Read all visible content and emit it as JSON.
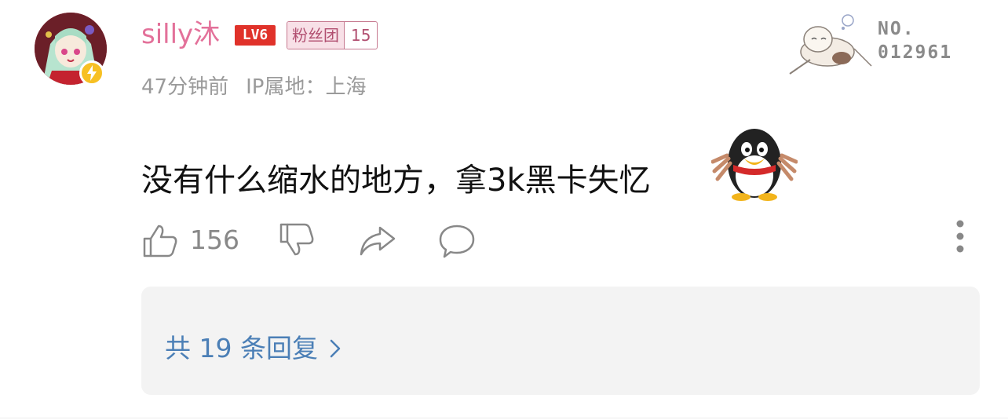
{
  "comment": {
    "author": {
      "name": "silly沐",
      "avatar_icon": "anime-avatar",
      "vip_icon": "lightning-icon",
      "level_label": "LV6",
      "fan_badge": {
        "name": "粉丝团",
        "level": "15"
      }
    },
    "time": "47分钟前",
    "ip_location": "IP属地：上海",
    "decoration": {
      "label": "NO.",
      "number": "012961",
      "icon": "sleeping-character-icon"
    },
    "text": "没有什么缩水的地方，拿3k黑卡失忆",
    "emoji_icon": "qq-penguin-emoji",
    "actions": {
      "like_count": "156",
      "like_icon": "thumbs-up-icon",
      "dislike_icon": "thumbs-down-icon",
      "share_icon": "share-icon",
      "comment_icon": "comment-bubble-icon",
      "more_icon": "more-vertical-icon"
    },
    "replies": {
      "label": "共 19 条回复",
      "icon": "chevron-right-icon"
    }
  },
  "colors": {
    "username": "#e3719a",
    "level_badge": "#e0322a",
    "link": "#4b7fb6",
    "meta_text": "#9a9a9a",
    "reply_bg": "#f3f3f3"
  }
}
